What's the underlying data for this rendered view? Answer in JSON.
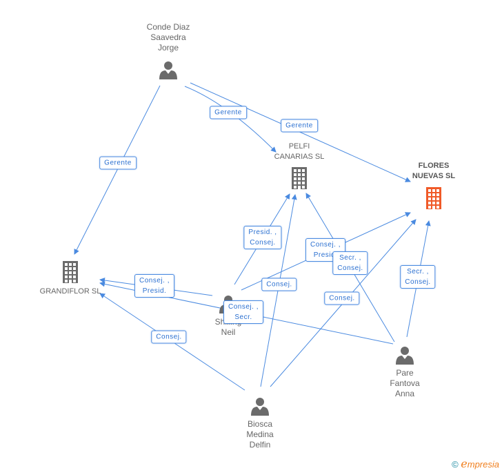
{
  "colors": {
    "edge": "#4a8ae0",
    "company": "#6b6b6b",
    "focus_company": "#f05a28",
    "person": "#6b6b6b"
  },
  "nodes": [
    {
      "id": "conde",
      "type": "person",
      "label": "Conde Diaz\nSaavedra\nJorge"
    },
    {
      "id": "pelfi",
      "type": "company",
      "label": "PELFI\nCANARIAS SL"
    },
    {
      "id": "flores",
      "type": "company",
      "focus": true,
      "label": "FLORES\nNUEVAS SL"
    },
    {
      "id": "grandiflor",
      "type": "company",
      "label": "GRANDIFLOR SL"
    },
    {
      "id": "shilling",
      "type": "person",
      "label": "Shilling\nNeil"
    },
    {
      "id": "pare",
      "type": "person",
      "label": "Pare\nFantova\nAnna"
    },
    {
      "id": "biosca",
      "type": "person",
      "label": "Biosca\nMedina\nDelfin"
    }
  ],
  "edges": [
    {
      "from": "conde",
      "to": "grandiflor",
      "label": "Gerente"
    },
    {
      "from": "conde",
      "to": "pelfi",
      "label": "Gerente"
    },
    {
      "from": "conde",
      "to": "flores",
      "label": "Gerente"
    },
    {
      "from": "shilling",
      "to": "pelfi",
      "label": "Presid. ,\nConsej."
    },
    {
      "from": "shilling",
      "to": "flores",
      "label": "Consej. ,\nPresid."
    },
    {
      "from": "shilling",
      "to": "grandiflor",
      "label": "Consej. ,\nPresid."
    },
    {
      "from": "pare",
      "to": "grandiflor",
      "label": "Consej. ,\nSecr."
    },
    {
      "from": "biosca",
      "to": "pelfi",
      "label": "Consej."
    },
    {
      "from": "biosca",
      "to": "flores",
      "label": "Consej."
    },
    {
      "from": "biosca",
      "to": "grandiflor",
      "label": "Consej."
    },
    {
      "from": "pare",
      "to": "pelfi",
      "label": "Secr. ,\nConsej."
    },
    {
      "from": "pare",
      "to": "flores",
      "label": "Secr. ,\nConsej."
    }
  ],
  "footer": {
    "copyright": "©",
    "brand": "mpresia",
    "brand_initial": "e"
  }
}
